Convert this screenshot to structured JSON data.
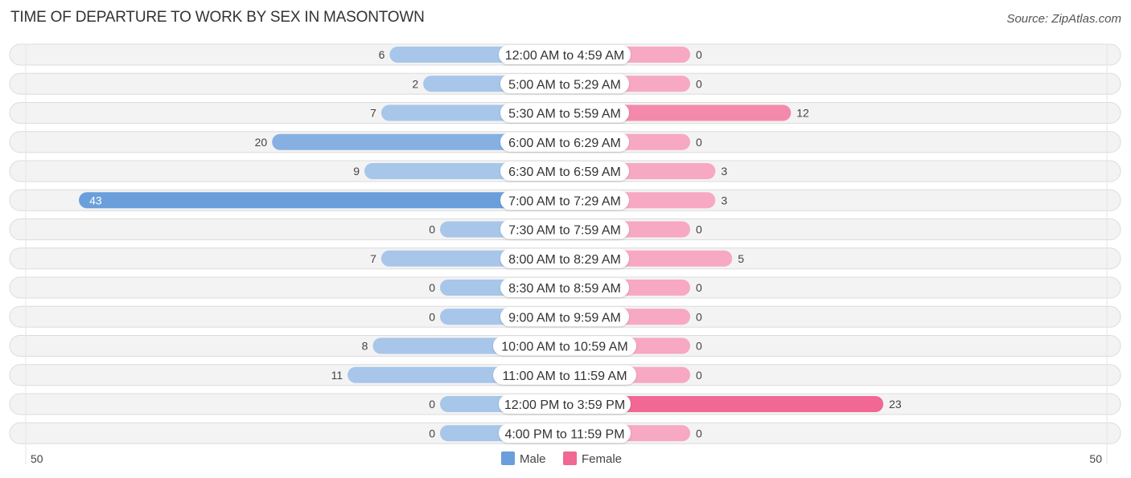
{
  "title": "TIME OF DEPARTURE TO WORK BY SEX IN MASONTOWN",
  "source": "Source: ZipAtlas.com",
  "colors": {
    "male_strong": "#6a9fdb",
    "male_light": "#a7c6ea",
    "female_strong": "#f06893",
    "female_light": "#f7a8c3"
  },
  "chart_data": {
    "type": "bar",
    "orientation": "horizontal-diverging",
    "title": "TIME OF DEPARTURE TO WORK BY SEX IN MASONTOWN",
    "categories": [
      "12:00 AM to 4:59 AM",
      "5:00 AM to 5:29 AM",
      "5:30 AM to 5:59 AM",
      "6:00 AM to 6:29 AM",
      "6:30 AM to 6:59 AM",
      "7:00 AM to 7:29 AM",
      "7:30 AM to 7:59 AM",
      "8:00 AM to 8:29 AM",
      "8:30 AM to 8:59 AM",
      "9:00 AM to 9:59 AM",
      "10:00 AM to 10:59 AM",
      "11:00 AM to 11:59 AM",
      "12:00 PM to 3:59 PM",
      "4:00 PM to 11:59 PM"
    ],
    "series": [
      {
        "name": "Male",
        "values": [
          6,
          2,
          7,
          20,
          9,
          43,
          0,
          7,
          0,
          0,
          8,
          11,
          0,
          0
        ]
      },
      {
        "name": "Female",
        "values": [
          0,
          0,
          12,
          0,
          3,
          3,
          0,
          5,
          0,
          0,
          0,
          0,
          23,
          0
        ]
      }
    ],
    "axis_range": [
      50,
      50
    ],
    "axis_labels": {
      "left": "50",
      "right": "50"
    },
    "legend": {
      "position": "bottom-center",
      "items": [
        "Male",
        "Female"
      ]
    }
  }
}
